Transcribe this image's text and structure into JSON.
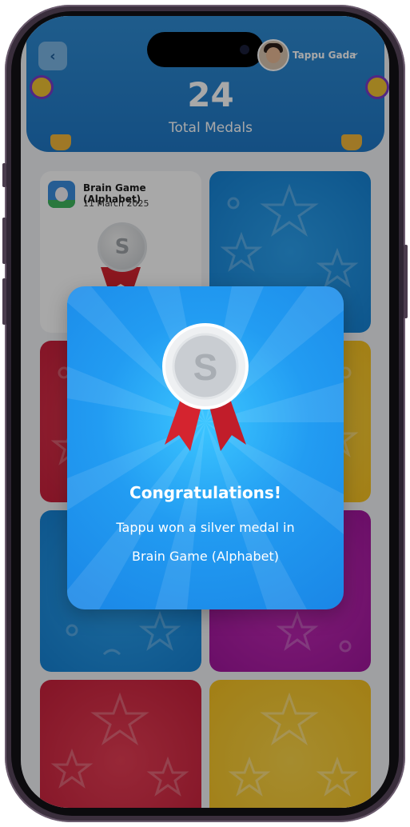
{
  "header": {
    "back_icon": "chevron-left-icon",
    "user_name": "Tappu Gada",
    "user_menu_icon": "chevron-down-icon",
    "medal_count": "24",
    "medal_label": "Total Medals"
  },
  "card": {
    "title": "Brain Game (Alphabet)",
    "date": "11 March 2025",
    "medal_letter": "S"
  },
  "modal": {
    "title": "Congratulations!",
    "line1": "Tappu won a silver medal in",
    "line2": "Brain Game (Alphabet)",
    "medal_letter": "S"
  },
  "colors": {
    "header_blue": "#1f78c6",
    "modal_blue": "#229cf2",
    "ribbon_red": "#d4242f",
    "silver": "#c4c8cc"
  }
}
